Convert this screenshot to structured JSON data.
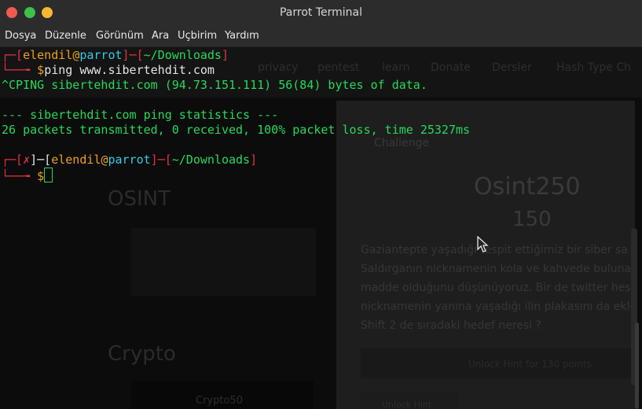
{
  "window": {
    "title": "Parrot Terminal"
  },
  "menu": {
    "items": [
      "Dosya",
      "Düzenle",
      "Görünüm",
      "Ara",
      "Uçbirim",
      "Yardım"
    ]
  },
  "prompt1": {
    "open": "┌─[",
    "user": "elendil",
    "at": "@",
    "host": "parrot",
    "sep": "]─[",
    "path": "~/Downloads",
    "close": "]",
    "corner": "└──╼ ",
    "dollar": "$",
    "command": "ping www.sibertehdit.com"
  },
  "output": {
    "line1": "^CPING sibertehdit.com (94.73.151.111) 56(84) bytes of data.",
    "line2": "--- sibertehdit.com ping statistics ---",
    "line3": "26 packets transmitted, 0 received, 100% packet loss, time 25327ms"
  },
  "prompt2": {
    "open": "┌─[",
    "x": "✗",
    "mid": "]─[",
    "user": "elendil",
    "at": "@",
    "host": "parrot",
    "sep": "]─[",
    "path": "~/Downloads",
    "close": "]",
    "corner": "└──╼ ",
    "dollar": "$"
  },
  "background": {
    "bookmarks": [
      "privacy",
      "pentest",
      "learn",
      "Donate",
      "Dersler",
      "Hash Type Ch"
    ],
    "challenge_tab": "Challenge",
    "challenge_name": "Osint250",
    "challenge_points": "150",
    "category1": "OSINT",
    "category2": "Crypto",
    "crypto_card": "Crypto50",
    "description": [
      "Gaziantepte yaşadığı tespit ettiğimiz bir siber sa",
      "Saldırganın nicknamenin kola ve kahvede bulunan",
      "madde olduğunu düşünüyoruz. Bir de twitter hes.",
      "nicknamenin yanına yaşadığı ilin plakasını da ekle",
      "Shift 2 de sıradaki hedef neresi ?"
    ],
    "unlock_button": "Unlock Hint for 130 points",
    "hint_button": "Unlock Hint"
  }
}
